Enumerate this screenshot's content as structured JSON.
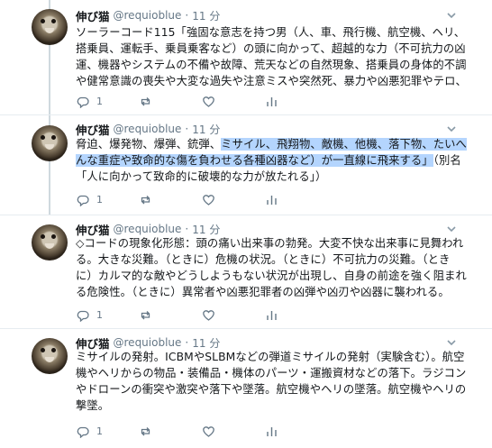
{
  "tweets": [
    {
      "name": "伸び猫",
      "handle": "@requioblue",
      "dot": "·",
      "time": "11 分",
      "lines": [
        [
          {
            "t": "ソーラーコード115「強固な意志を持つ男（人、車、飛行機、航空機、ヘリ、"
          }
        ],
        [
          {
            "t": "搭乗員、運転手、乗員乗客など）の頭に向かって、超越的な力（不可抗力の凶"
          }
        ],
        [
          {
            "t": "運、機器やシステムの不備や故障、荒天などの自然現象、搭乗員の身体的不調"
          }
        ],
        [
          {
            "t": "や健常意識の喪失や大変な過失や注意ミスや突然死、暴力や凶悪犯罪やテロ、"
          }
        ]
      ],
      "reply_count": "1",
      "retweet_count": "",
      "like_count": ""
    },
    {
      "name": "伸び猫",
      "handle": "@requioblue",
      "dot": "·",
      "time": "11 分",
      "lines": [
        [
          {
            "t": "脅迫、爆発物、爆弾、銃弾、"
          },
          {
            "t": "ミサイル、飛翔物、敵機、他機、落下物、たいへ",
            "hl": true
          }
        ],
        [
          {
            "t": "んな重症や致命的な傷を負わせる各種凶器など）が一直線に飛来する」",
            "hl": true
          },
          {
            "t": "（別名"
          }
        ],
        [
          {
            "t": "「人に向かって致命的に破壊的な力が放たれる」）"
          }
        ]
      ],
      "reply_count": "1",
      "retweet_count": "",
      "like_count": ""
    },
    {
      "name": "伸び猫",
      "handle": "@requioblue",
      "dot": "·",
      "time": "11 分",
      "lines": [
        [
          {
            "t": "◇コードの現象化形態：頭の痛い出来事の勃発。大変不快な出来事に見舞われ"
          }
        ],
        [
          {
            "t": "る。大きな災難。（ときに）危機の状況。（ときに）不可抗力の災難。（とき"
          }
        ],
        [
          {
            "t": "に）カルマ的な敵やどうしようもない状況が出現し、自身の前途を強く阻まれ"
          }
        ],
        [
          {
            "t": "る危険性。（ときに）異常者や凶悪犯罪者の凶弾や凶刃や凶器に襲われる。"
          }
        ]
      ],
      "reply_count": "1",
      "retweet_count": "",
      "like_count": ""
    },
    {
      "name": "伸び猫",
      "handle": "@requioblue",
      "dot": "·",
      "time": "11 分",
      "lines": [
        [
          {
            "t": "ミサイルの発射。ICBMやSLBMなどの弾道ミサイルの発射（実験含む）。航空"
          }
        ],
        [
          {
            "t": "機やヘリからの物品・装備品・機体のパーツ・運搬資材などの落下。ラジコン"
          }
        ],
        [
          {
            "t": "やドローンの衝突や激突や落下や墜落。航空機やヘリの墜落。航空機やヘリの"
          }
        ],
        [
          {
            "t": "撃墜。"
          }
        ]
      ],
      "reply_count": "1",
      "retweet_count": "",
      "like_count": ""
    }
  ],
  "icons": {
    "reply": "reply-icon",
    "retweet": "retweet-icon",
    "like": "like-icon",
    "analytics": "analytics-icon",
    "menu": "chevron-down-icon"
  },
  "colors": {
    "selection_highlight": "#b4d5fe",
    "secondary_text": "#657786",
    "thread_line": "#cfd9de"
  }
}
